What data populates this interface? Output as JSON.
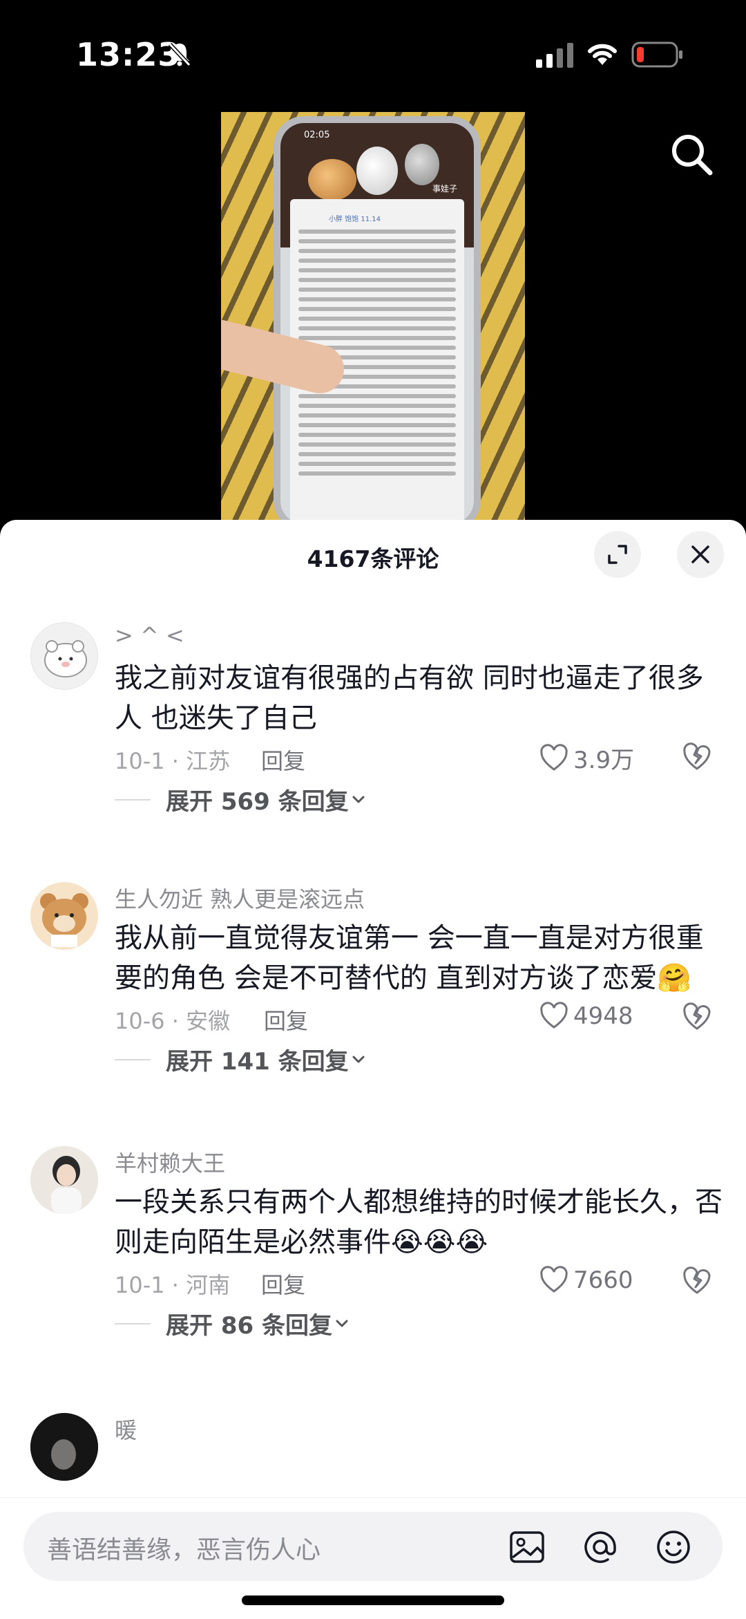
{
  "status_bar": {
    "time": "13:23"
  },
  "video": {
    "phone_clock": "02:05",
    "phone_label": "事娃子",
    "phone_name": "小胖 饱饱 11.14"
  },
  "comments_panel": {
    "title": "4167条评论",
    "comments": [
      {
        "username": "> ^ <",
        "text": "我之前对友谊有很强的占有欲 同时也逼走了很多人 也迷失了自己",
        "date_location": "10-1 · 江苏",
        "reply_label": "回复",
        "likes": "3.9万",
        "expand_label": "展开 569 条回复"
      },
      {
        "username": "生人勿近 熟人更是滚远点",
        "text": "我从前一直觉得友谊第一 会一直一直是对方很重要的角色 会是不可替代的 直到对方谈了恋爱🤗",
        "date_location": "10-6 · 安徽",
        "reply_label": "回复",
        "likes": "4948",
        "expand_label": "展开 141 条回复"
      },
      {
        "username": "羊村赖大王",
        "text": "一段关系只有两个人都想维持的时候才能长久，否则走向陌生是必然事件😭😭😭",
        "date_location": "10-1 · 河南",
        "reply_label": "回复",
        "likes": "7660",
        "expand_label": "展开 86 条回复"
      },
      {
        "username": "暖"
      }
    ]
  },
  "input_bar": {
    "placeholder": "善语结善缘，恶言伤人心"
  }
}
